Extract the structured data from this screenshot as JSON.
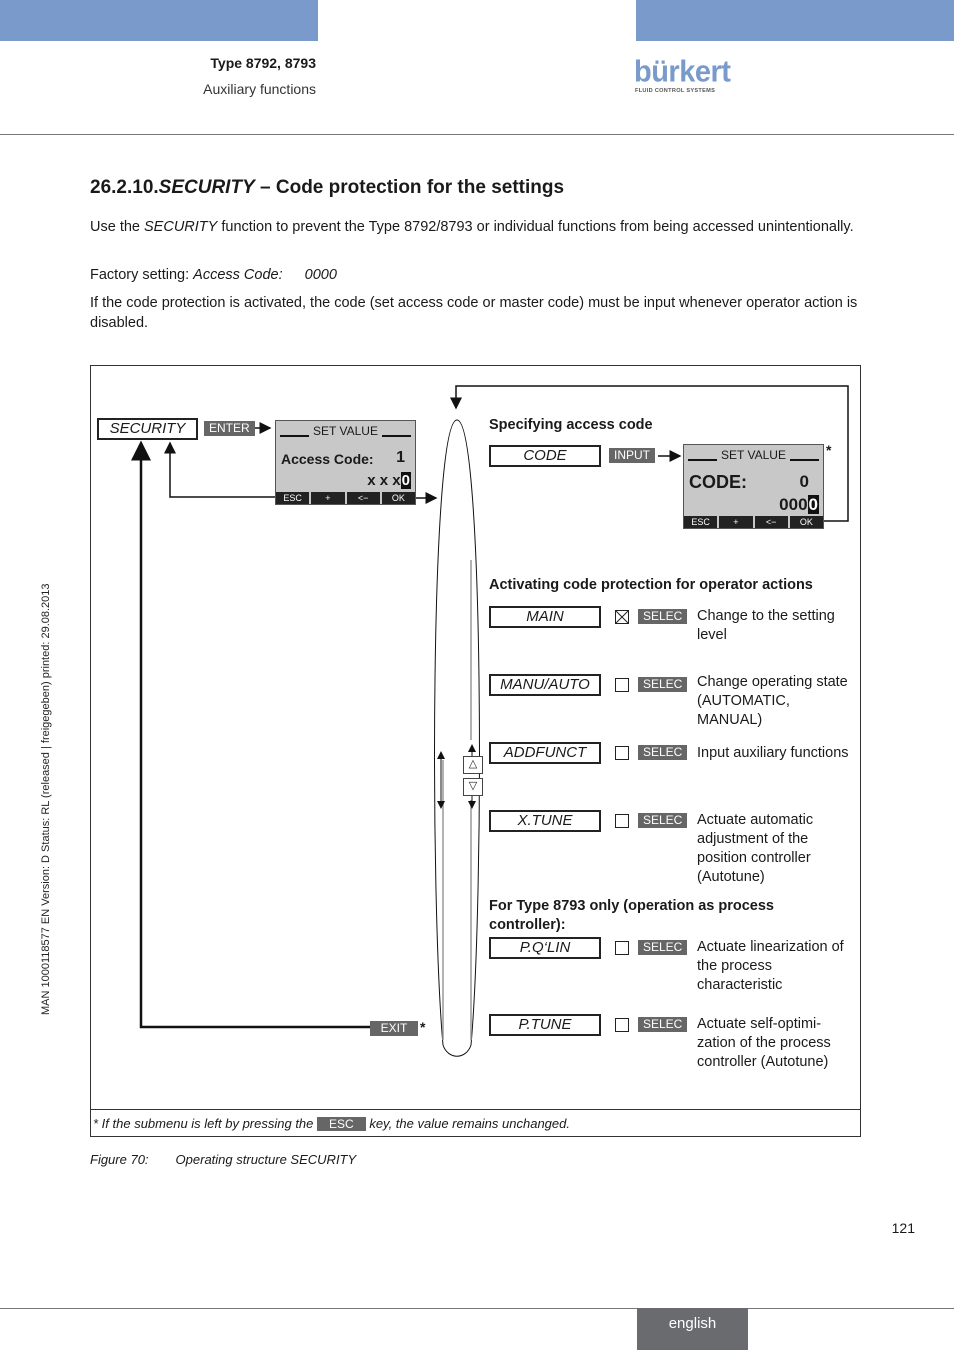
{
  "header": {
    "product": "Type 8792, 8793",
    "chapter": "Auxiliary functions",
    "logo_word": "bürkert",
    "logo_tagline": "FLUID CONTROL SYSTEMS",
    "brand_color": "#7a9acb"
  },
  "side_text": "MAN  1000118577  EN  Version: D  Status: RL (released | freigegeben)  printed: 29.08.2013",
  "section": {
    "number": "26.2.10.",
    "title_italic": "SECURITY",
    "title_rest": " – Code protection for the settings"
  },
  "paragraphs": {
    "p1_a": "Use the ",
    "p1_b": "SECURITY",
    "p1_c": " function to prevent the Type 8792/8793 or individual functions from being accessed unintentionally.",
    "p2_label": "Factory setting: ",
    "p2_key": "Access Code:",
    "p2_value": "0000",
    "p3": "If the code protection is activated, the code (set access code or master code) must be input whenever operator action is disabled."
  },
  "figure": {
    "security_box": "SECURITY",
    "enter_key": "ENTER",
    "exit_key": "EXIT",
    "asterisk": "*",
    "lcd1": {
      "title": "SET VALUE",
      "label": "Access Code:",
      "value": "1",
      "entry_prefix": "x x x",
      "entry_cursor": "0",
      "keys": [
        "ESC",
        "+",
        "<−",
        "OK"
      ]
    },
    "specifying_heading": "Specifying access code",
    "code_box": "CODE",
    "input_key": "INPUT",
    "lcd2": {
      "title": "SET VALUE",
      "label": "CODE:",
      "value": "0",
      "entry_prefix": "000",
      "entry_cursor": "0",
      "keys": [
        "ESC",
        "+",
        "<−",
        "OK"
      ]
    },
    "activating_heading": "Activating code protection for operator actions",
    "type8793_heading": "For Type 8793 only (operation as process controller):",
    "select_key": "SELEC",
    "items": [
      {
        "menu": "MAIN",
        "checked": true,
        "desc": "Change to the setting level"
      },
      {
        "menu": "MANU/AUTO",
        "checked": false,
        "desc": "Change operating state (AUTOMATIC, MANUAL)"
      },
      {
        "menu": "ADDFUNCT",
        "checked": false,
        "desc": "Input auxiliary functions"
      },
      {
        "menu": "X.TUNE",
        "checked": false,
        "desc": "Actuate automatic adjustment of the position controller (Autotune)"
      },
      {
        "menu": "P.Q‘LIN",
        "checked": false,
        "desc": "Actuate linearization of the process characteristic"
      },
      {
        "menu": "P.TUNE",
        "checked": false,
        "desc": "Actuate self-optimi-zation of the process controller (Autotune)"
      }
    ],
    "footnote_a": "* If the submenu is left by pressing the ",
    "footnote_key": "ESC",
    "footnote_b": " key, the value remains unchanged."
  },
  "caption": {
    "label": "Figure 70:",
    "text": "Operating structure SECURITY"
  },
  "footer": {
    "page_number": "121",
    "language": "english"
  }
}
